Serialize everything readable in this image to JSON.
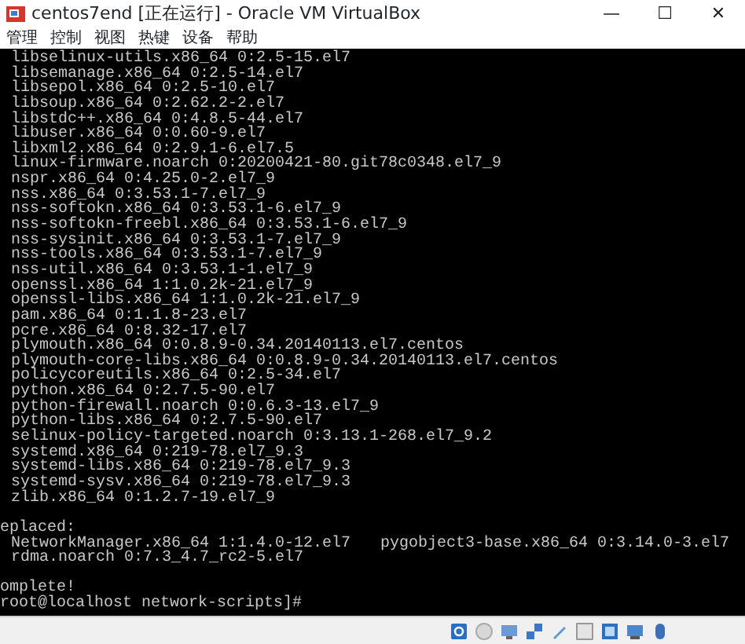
{
  "window": {
    "title": "centos7end [正在运行] - Oracle VM VirtualBox",
    "controls": [
      "—",
      "☐",
      "✕"
    ]
  },
  "menu": [
    "管理",
    "控制",
    "视图",
    "热键",
    "设备",
    "帮助"
  ],
  "terminal": {
    "lines": [
      {
        "kind": "entry",
        "cells": [
          "libselinux-utils.x86_64 0:2.5-15.el7"
        ]
      },
      {
        "kind": "entry",
        "cells": [
          "libsemanage.x86_64 0:2.5-14.el7"
        ]
      },
      {
        "kind": "entry",
        "cells": [
          "libsepol.x86_64 0:2.5-10.el7"
        ]
      },
      {
        "kind": "entry",
        "cells": [
          "libsoup.x86_64 0:2.62.2-2.el7"
        ]
      },
      {
        "kind": "entry",
        "cells": [
          "libstdc++.x86_64 0:4.8.5-44.el7"
        ]
      },
      {
        "kind": "entry",
        "cells": [
          "libuser.x86_64 0:0.60-9.el7"
        ]
      },
      {
        "kind": "entry",
        "cells": [
          "libxml2.x86_64 0:2.9.1-6.el7.5"
        ]
      },
      {
        "kind": "entry",
        "cells": [
          "linux-firmware.noarch 0:20200421-80.git78c0348.el7_9"
        ]
      },
      {
        "kind": "entry",
        "cells": [
          "nspr.x86_64 0:4.25.0-2.el7_9"
        ]
      },
      {
        "kind": "entry",
        "cells": [
          "nss.x86_64 0:3.53.1-7.el7_9"
        ]
      },
      {
        "kind": "entry",
        "cells": [
          "nss-softokn.x86_64 0:3.53.1-6.el7_9"
        ]
      },
      {
        "kind": "entry",
        "cells": [
          "nss-softokn-freebl.x86_64 0:3.53.1-6.el7_9"
        ]
      },
      {
        "kind": "entry",
        "cells": [
          "nss-sysinit.x86_64 0:3.53.1-7.el7_9"
        ]
      },
      {
        "kind": "entry",
        "cells": [
          "nss-tools.x86_64 0:3.53.1-7.el7_9"
        ]
      },
      {
        "kind": "entry",
        "cells": [
          "nss-util.x86_64 0:3.53.1-1.el7_9"
        ]
      },
      {
        "kind": "entry",
        "cells": [
          "openssl.x86_64 1:1.0.2k-21.el7_9"
        ]
      },
      {
        "kind": "entry",
        "cells": [
          "openssl-libs.x86_64 1:1.0.2k-21.el7_9"
        ]
      },
      {
        "kind": "entry",
        "cells": [
          "pam.x86_64 0:1.1.8-23.el7"
        ]
      },
      {
        "kind": "entry",
        "cells": [
          "pcre.x86_64 0:8.32-17.el7"
        ]
      },
      {
        "kind": "entry",
        "cells": [
          "plymouth.x86_64 0:0.8.9-0.34.20140113.el7.centos"
        ]
      },
      {
        "kind": "entry",
        "cells": [
          "plymouth-core-libs.x86_64 0:0.8.9-0.34.20140113.el7.centos"
        ]
      },
      {
        "kind": "entry",
        "cells": [
          "policycoreutils.x86_64 0:2.5-34.el7"
        ]
      },
      {
        "kind": "entry",
        "cells": [
          "python.x86_64 0:2.7.5-90.el7"
        ]
      },
      {
        "kind": "entry",
        "cells": [
          "python-firewall.noarch 0:0.6.3-13.el7_9"
        ]
      },
      {
        "kind": "entry",
        "cells": [
          "python-libs.x86_64 0:2.7.5-90.el7"
        ]
      },
      {
        "kind": "entry",
        "cells": [
          "selinux-policy-targeted.noarch 0:3.13.1-268.el7_9.2"
        ]
      },
      {
        "kind": "entry",
        "cells": [
          "systemd.x86_64 0:219-78.el7_9.3"
        ]
      },
      {
        "kind": "entry",
        "cells": [
          "systemd-libs.x86_64 0:219-78.el7_9.3"
        ]
      },
      {
        "kind": "entry",
        "cells": [
          "systemd-sysv.x86_64 0:219-78.el7_9.3"
        ]
      },
      {
        "kind": "entry",
        "cells": [
          "zlib.x86_64 0:1.2.7-19.el7_9"
        ]
      },
      {
        "kind": "blank"
      },
      {
        "kind": "plain",
        "text": "eplaced:"
      },
      {
        "kind": "entry",
        "cells": [
          "NetworkManager.x86_64 1:1.4.0-12.el7",
          "pygobject3-base.x86_64 0:3.14.0-3.el7"
        ]
      },
      {
        "kind": "entry",
        "cells": [
          "rdma.noarch 0:7.3_4.7_rc2-5.el7"
        ]
      },
      {
        "kind": "blank"
      },
      {
        "kind": "plain",
        "text": "omplete!"
      },
      {
        "kind": "plain",
        "text": "root@localhost network-scripts]#"
      }
    ]
  }
}
